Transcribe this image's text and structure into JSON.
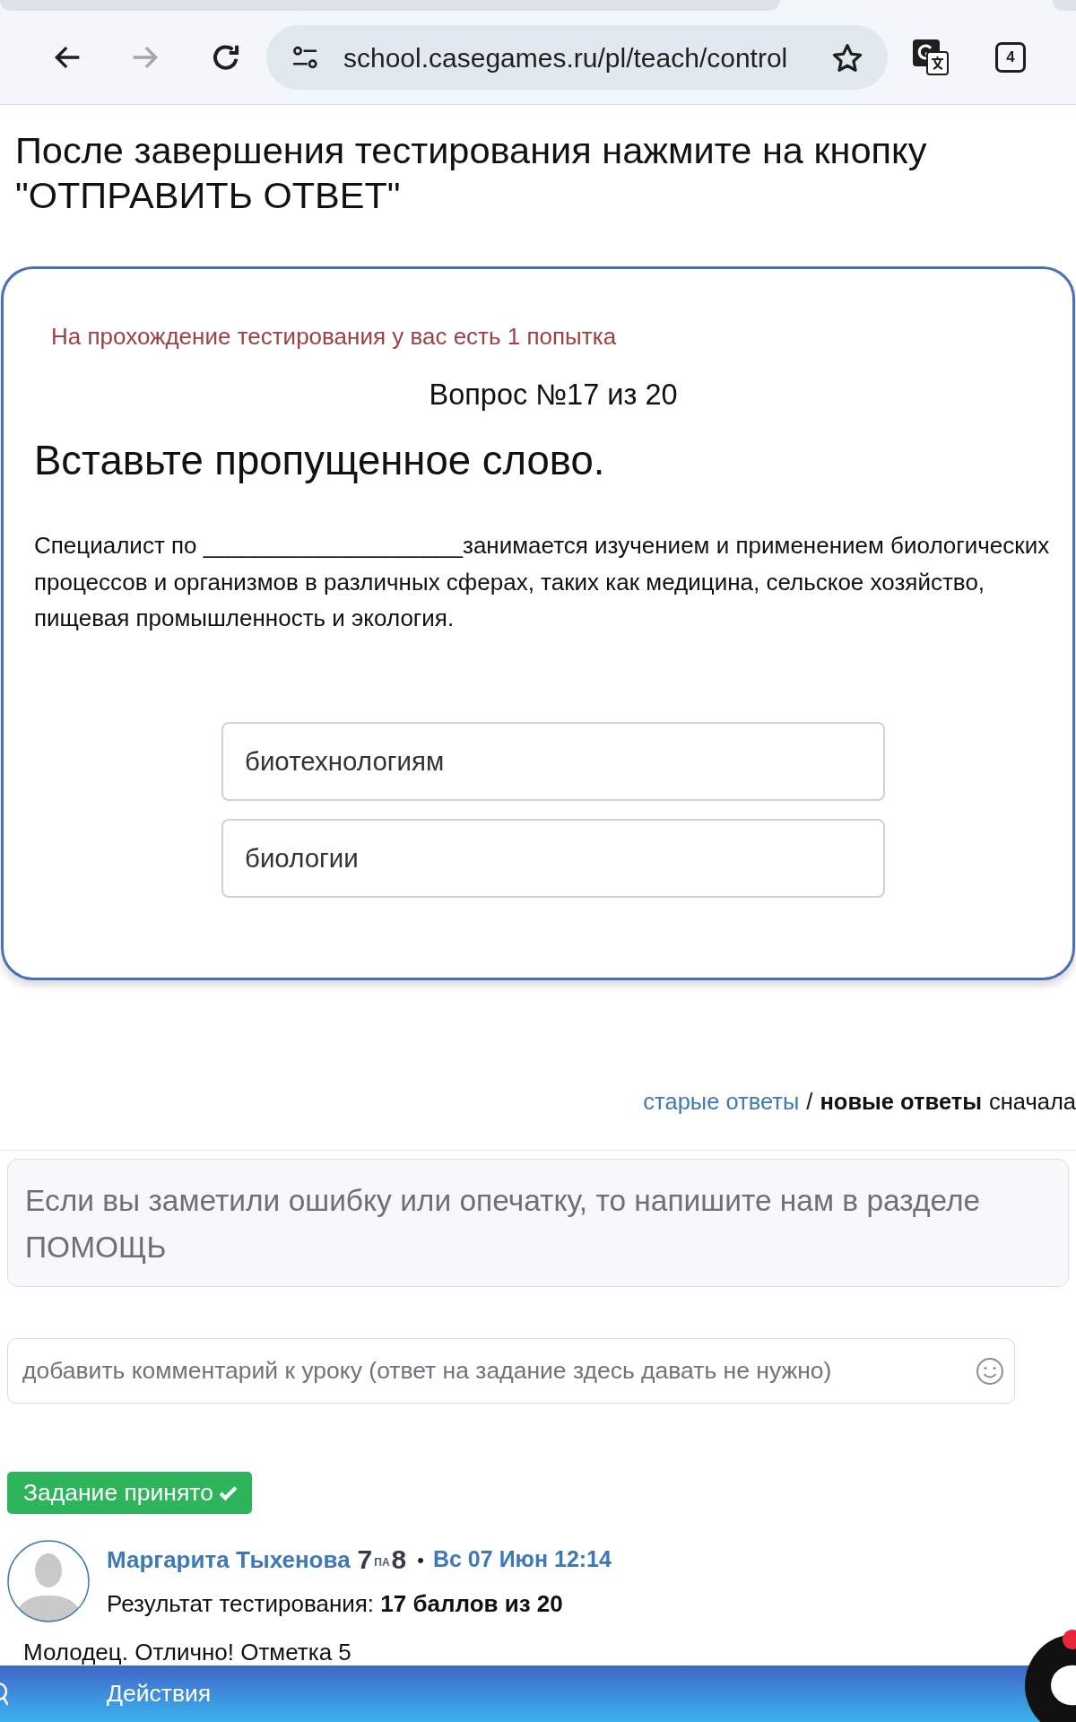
{
  "browser": {
    "url": "school.casegames.ru/pl/teach/control",
    "tab_count": "4",
    "forward_disabled": true
  },
  "instruction": "После завершения тестирования нажмите на кнопку \"ОТПРАВИТЬ ОТВЕТ\"",
  "quiz": {
    "attempts_note": "На прохождение тестирования у вас есть 1 попытка",
    "counter": "Вопрос №17 из 20",
    "title": "Вставьте пропущенное слово.",
    "question": "Специалист по ____________________занимается изучением и применением биологических процессов и организмов в различных сферах, таких как медицина, сельское хозяйство, пищевая промышленность и экология.",
    "options": [
      {
        "label": "биотехнологиям",
        "selected": false
      },
      {
        "label": "биологии",
        "selected": false
      }
    ]
  },
  "sort": {
    "options": [
      {
        "label": "старые ответы",
        "selected": false
      },
      {
        "label": "новые ответы",
        "selected": true
      }
    ],
    "separator": "/",
    "suffix": "сначала"
  },
  "notice": "Если вы заметили ошибку или опечатку, то напишите нам в разделе ПОМОЩЬ",
  "comment": {
    "placeholder": "добавить комментарий к уроку (ответ на задание здесь давать не нужно)"
  },
  "status_button": "Задание принято",
  "answer": {
    "author": "Маргарита Тыхенова",
    "badge": [
      "7",
      "ПА",
      "8"
    ],
    "separator": "•",
    "date": "Вс 07 Июн 12:14",
    "result": "Результат тестирования: **17 баллов из 20**",
    "feedback": "Молодец. Отлично! Отметка 5"
  },
  "bottom_bar": {
    "label": "Действия"
  }
}
